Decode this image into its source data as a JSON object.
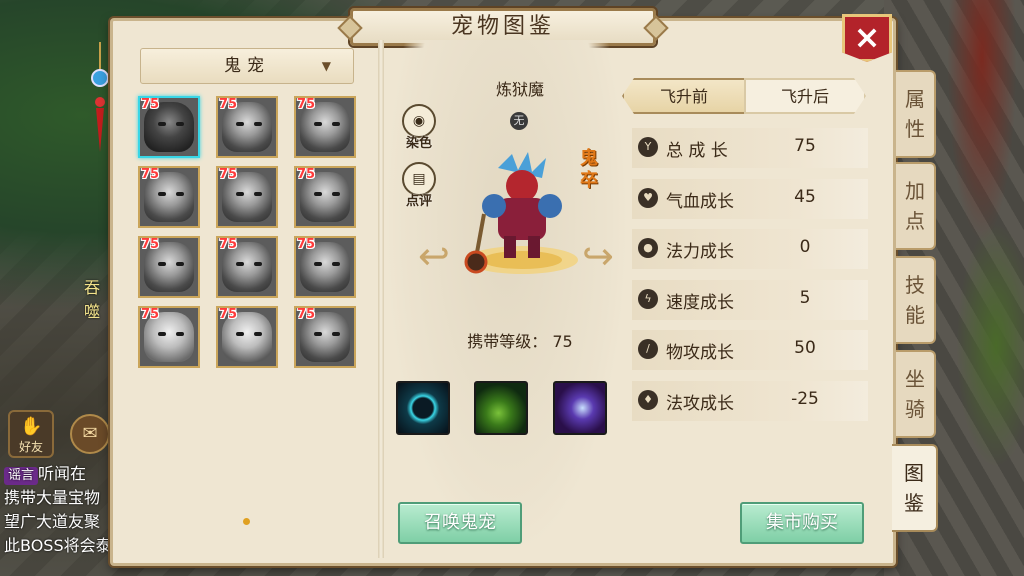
{
  "window": {
    "title": "宠物图鉴",
    "close_icon": "×"
  },
  "category": {
    "selected": "鬼宠"
  },
  "pets": [
    {
      "level": "75"
    },
    {
      "level": "75"
    },
    {
      "level": "75"
    },
    {
      "level": "75"
    },
    {
      "level": "75"
    },
    {
      "level": "75"
    },
    {
      "level": "75"
    },
    {
      "level": "75"
    },
    {
      "level": "75"
    },
    {
      "level": "75"
    },
    {
      "level": "75"
    },
    {
      "level": "75"
    }
  ],
  "detail": {
    "name": "炼狱魔",
    "element": "无",
    "type_label": "鬼卒",
    "dye_label": "染色",
    "review_label": "点评",
    "carry_level": "携带等级： 75"
  },
  "stage_tabs": {
    "before": "飞升前",
    "after": "飞升后"
  },
  "stats": [
    {
      "label": "总 成 长",
      "value": "75"
    },
    {
      "label": "气血成长",
      "value": "45"
    },
    {
      "label": "法力成长",
      "value": "0"
    },
    {
      "label": "速度成长",
      "value": "5"
    },
    {
      "label": "物攻成长",
      "value": "50"
    },
    {
      "label": "法攻成长",
      "value": "-25"
    }
  ],
  "buttons": {
    "summon": "召唤鬼宠",
    "market": "集市购买"
  },
  "side_tabs": [
    {
      "c1": "属",
      "c2": "性"
    },
    {
      "c1": "加",
      "c2": "点"
    },
    {
      "c1": "技",
      "c2": "能"
    },
    {
      "c1": "坐",
      "c2": "骑"
    },
    {
      "c1": "图",
      "c2": "鉴"
    }
  ],
  "background": {
    "friend_label": "好友",
    "chat_tag": "谣言",
    "chat_lines": [
      "听闻在",
      "携带大量宝物",
      "望广大道友聚",
      "此BOSS将会泰"
    ],
    "scene_text": "吞噬"
  }
}
